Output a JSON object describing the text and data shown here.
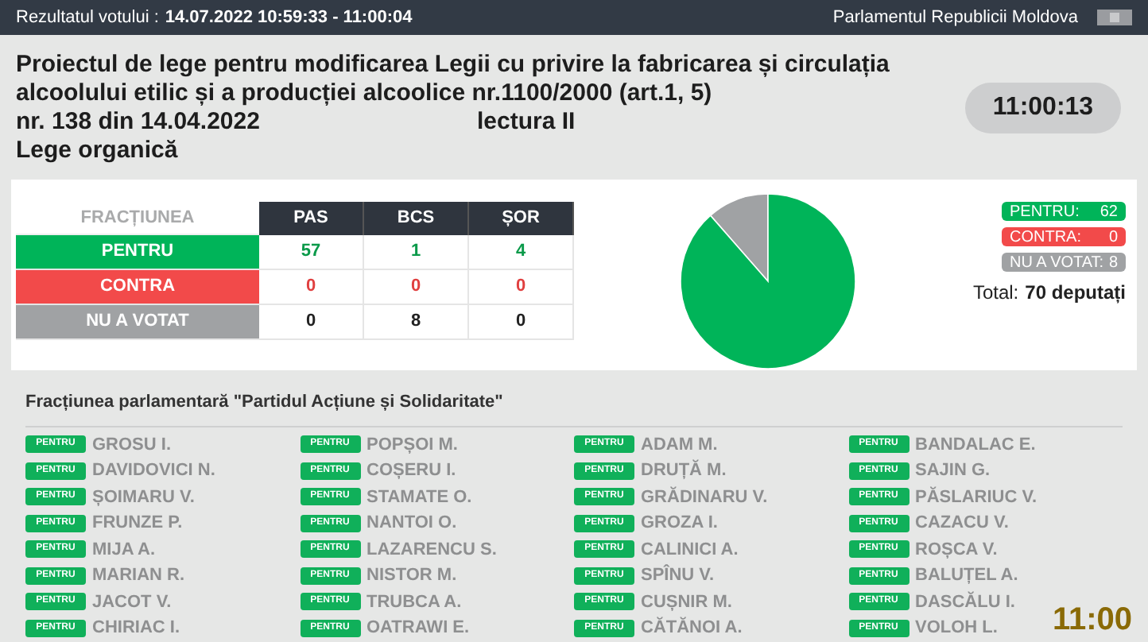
{
  "header": {
    "vote_label": "Rezultatul votului :",
    "vote_time": "14.07.2022 10:59:33 - 11:00:04",
    "institution": "Parlamentul Republicii Moldova"
  },
  "bill": {
    "title_lines": [
      "Proiectul de lege pentru modificarea Legii cu privire la fabricarea și circulația",
      "alcoolului etilic și a producției alcoolice nr.1100/2000 (art.1, 5)"
    ],
    "number": "nr. 138 din 14.04.2022",
    "reading": "lectura II",
    "law_type": "Lege organică",
    "clock": "11:00:13"
  },
  "results_table": {
    "corner": "FRACȚIUNEA",
    "columns": [
      "PAS",
      "BCS",
      "ȘOR"
    ],
    "rows": [
      {
        "kind": "for",
        "label": "PENTRU",
        "values": [
          "57",
          "1",
          "4"
        ]
      },
      {
        "kind": "against",
        "label": "CONTRA",
        "values": [
          "0",
          "0",
          "0"
        ]
      },
      {
        "kind": "absent",
        "label": "NU A VOTAT",
        "values": [
          "0",
          "8",
          "0"
        ]
      }
    ]
  },
  "legend": [
    {
      "kind": "for",
      "label": "PENTRU:",
      "value": "62"
    },
    {
      "kind": "against",
      "label": "CONTRA:",
      "value": "0"
    },
    {
      "kind": "absent",
      "label": "NU A VOTAT:",
      "value": "8"
    }
  ],
  "total": {
    "label": "Total:",
    "value": "70 deputați"
  },
  "faction": {
    "title": "Fracțiunea parlamentară \"Partidul Acțiune și Solidaritate\"",
    "columns": [
      [
        {
          "vote": "PENTRU",
          "name": "GROSU I."
        },
        {
          "vote": "PENTRU",
          "name": "DAVIDOVICI N."
        },
        {
          "vote": "PENTRU",
          "name": "ȘOIMARU V."
        },
        {
          "vote": "PENTRU",
          "name": "FRUNZE P."
        },
        {
          "vote": "PENTRU",
          "name": "MIJA A."
        },
        {
          "vote": "PENTRU",
          "name": "MARIAN R."
        },
        {
          "vote": "PENTRU",
          "name": "JACOT V."
        },
        {
          "vote": "PENTRU",
          "name": "CHIRIAC I."
        }
      ],
      [
        {
          "vote": "PENTRU",
          "name": "POPȘOI M."
        },
        {
          "vote": "PENTRU",
          "name": "COȘERU I."
        },
        {
          "vote": "PENTRU",
          "name": "STAMATE O."
        },
        {
          "vote": "PENTRU",
          "name": "NANTOI O."
        },
        {
          "vote": "PENTRU",
          "name": "LAZARENCU S."
        },
        {
          "vote": "PENTRU",
          "name": "NISTOR M."
        },
        {
          "vote": "PENTRU",
          "name": "TRUBCA A."
        },
        {
          "vote": "PENTRU",
          "name": "OATRAWI E."
        }
      ],
      [
        {
          "vote": "PENTRU",
          "name": "ADAM M."
        },
        {
          "vote": "PENTRU",
          "name": "DRUȚĂ M."
        },
        {
          "vote": "PENTRU",
          "name": "GRĂDINARU V."
        },
        {
          "vote": "PENTRU",
          "name": "GROZA I."
        },
        {
          "vote": "PENTRU",
          "name": "CALINICI A."
        },
        {
          "vote": "PENTRU",
          "name": "SPÎNU V."
        },
        {
          "vote": "PENTRU",
          "name": "CUȘNIR M."
        },
        {
          "vote": "PENTRU",
          "name": "CĂTĂNOI A."
        }
      ],
      [
        {
          "vote": "PENTRU",
          "name": "BANDALAC E."
        },
        {
          "vote": "PENTRU",
          "name": "SAJIN G."
        },
        {
          "vote": "PENTRU",
          "name": "PĂSLARIUC V."
        },
        {
          "vote": "PENTRU",
          "name": "CAZACU V."
        },
        {
          "vote": "PENTRU",
          "name": "ROȘCA V."
        },
        {
          "vote": "PENTRU",
          "name": "BALUȚEL A."
        },
        {
          "vote": "PENTRU",
          "name": "DASCĂLU I."
        },
        {
          "vote": "PENTRU",
          "name": "VOLOH L."
        }
      ]
    ]
  },
  "broadcast_clock": "11:00"
}
